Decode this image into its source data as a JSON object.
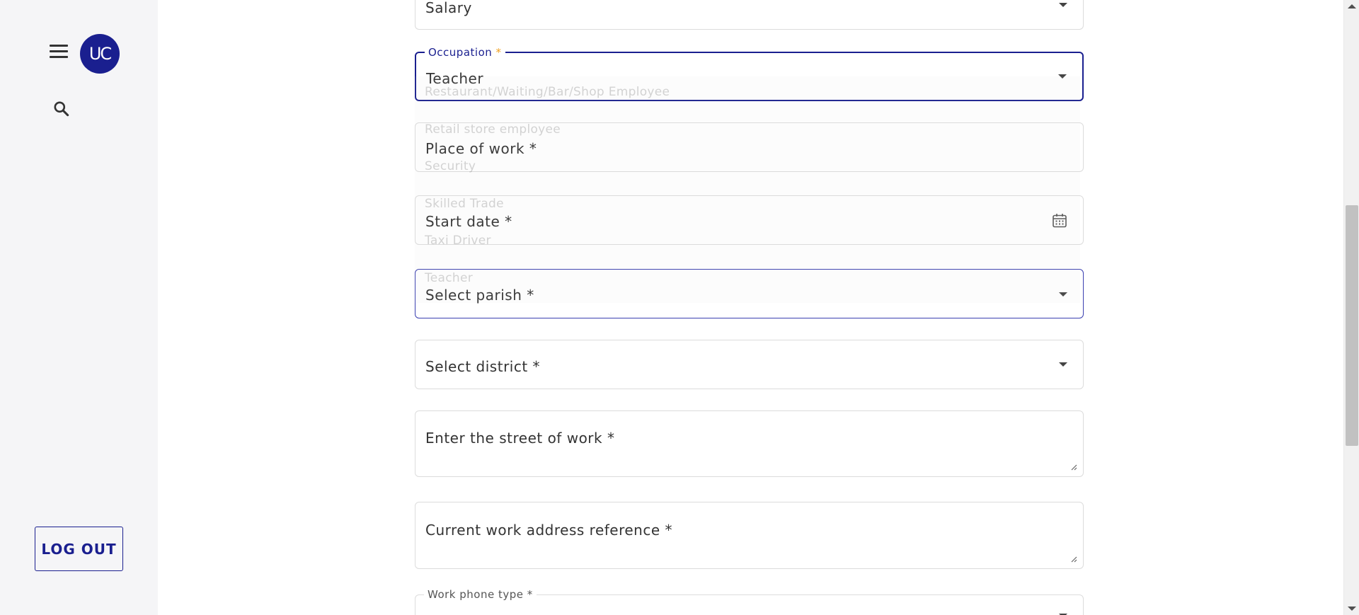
{
  "sidebar": {
    "avatar_initials": "UC",
    "logout_label": "LOG OUT"
  },
  "form": {
    "income_type_value": "Salary",
    "occupation": {
      "label": "Occupation",
      "required_mark": "*",
      "value": "Teacher"
    },
    "place_of_work_label": "Place of work *",
    "start_date_label": "Start date *",
    "parish_label": "Select parish *",
    "district_label": "Select district *",
    "street_label": "Enter the street of work *",
    "address_reference_label": "Current work address reference *",
    "phone_type_label": "Work phone type *"
  },
  "occupation_options": [
    "Restaurant/Waiting/Bar/Shop Employee",
    "Retail store employee",
    "Security",
    "Skilled Trade",
    "Taxi Driver",
    "Teacher"
  ],
  "colors": {
    "primary": "#1a1f8f",
    "required_star": "#f0a020"
  }
}
